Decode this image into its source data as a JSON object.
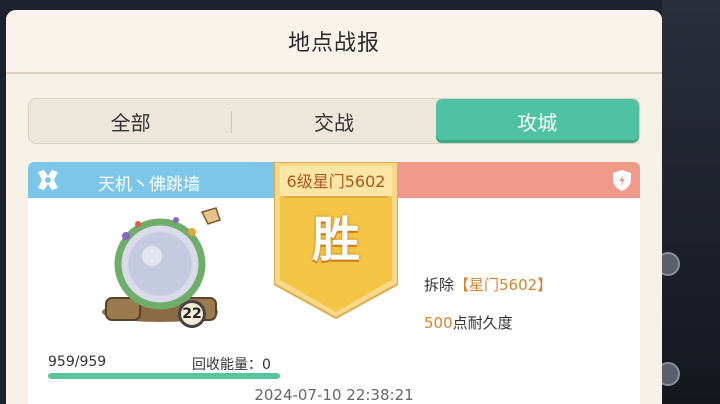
{
  "header": {
    "title": "地点战报"
  },
  "tabs": [
    {
      "label": "全部",
      "active": false
    },
    {
      "label": "交战",
      "active": false
    },
    {
      "label": "攻城",
      "active": true
    }
  ],
  "report": {
    "attacker_name": "天机丶佛跳墙",
    "target_label": "6级星门5602",
    "result": "胜",
    "building_level": "22",
    "hp_text": "959/959",
    "hp_fraction": 1.0,
    "recycle_label": "回收能量：",
    "recycle_value": "0",
    "timestamp": "2024-07-10 22:38:21",
    "detail_action": "拆除",
    "detail_target": "【星门5602】",
    "detail_value": "500",
    "detail_suffix": "点耐久度"
  },
  "colors": {
    "accent_green": "#4fc3a1",
    "attacker_blue": "#7cc6ea",
    "defender_red": "#f29a8a",
    "banner_gold": "#f4c545",
    "highlight_orange": "#d9822b"
  },
  "icons": {
    "alliance": "alliance-emblem-icon",
    "defender": "shield-icon"
  }
}
